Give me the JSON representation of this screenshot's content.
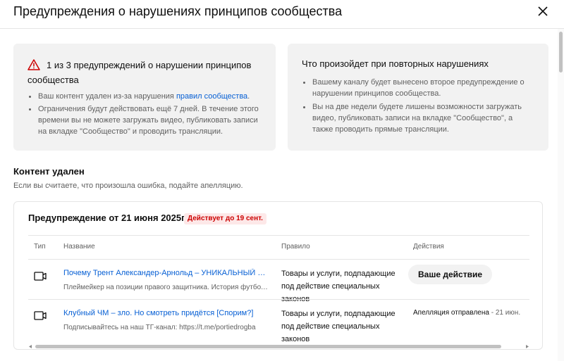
{
  "dialog": {
    "title": "Предупреждения о нарушениях принципов сообщества"
  },
  "strike_card": {
    "title": "1 из 3 предупреждений о нарушении принципов сообщества",
    "bullet1_prefix": "Ваш контент удален из-за нарушения ",
    "bullet1_link": "правил сообщества",
    "bullet1_suffix": ".",
    "bullet2": "Ограничения будут действовать ещё 7 дней. В течение этого времени вы не можете загружать видео, публиковать записи на вкладке \"Сообщество\" и проводить трансляции."
  },
  "repeat_card": {
    "title": "Что произойдет при повторных нарушениях",
    "bullets": [
      "Вашему каналу будет вынесено второе предупреждение о нарушении принципов сообщества.",
      "Вы на две недели будете лишены возможности загружать видео, публиковать записи на вкладке \"Сообщество\", а также проводить прямые трансляции."
    ]
  },
  "content_section": {
    "title": "Контент удален",
    "subtitle": "Если вы считаете, что произошла ошибка, подайте апелляцию."
  },
  "warning_box": {
    "title": "Предупреждение от 21 июня 2025г.",
    "badge": "Действует до 19 сент.",
    "badge_color": "#cc0000",
    "columns": {
      "type": "Тип",
      "name": "Название",
      "rule": "Правило",
      "actions": "Действия"
    },
    "rows": [
      {
        "icon": "video-icon",
        "title": "Почему Трент Александер-Арнольд – УНИКАЛЬНЫЙ футболист",
        "description": "Плеймейкер на позиции правого защитника. История футболиста",
        "rule": "Товары и услуги, подпадающие под действие специальных законов",
        "action_label": "Ваше действие"
      },
      {
        "icon": "video-icon",
        "title": "Клубный ЧМ – зло. Но смотреть придётся [Спорим?]",
        "description": "Подписывайтесь на наш ТГ-канал: https://t.me/portiedrogba",
        "rule": "Товары и услуги, подпадающие под действие специальных законов",
        "appeal_status": "Апелляция отправлена",
        "appeal_date": " - 21 июн."
      }
    ]
  },
  "colors": {
    "link": "#065fd4",
    "card_bg": "#f2f2f2",
    "warning_red": "#cc0000"
  }
}
